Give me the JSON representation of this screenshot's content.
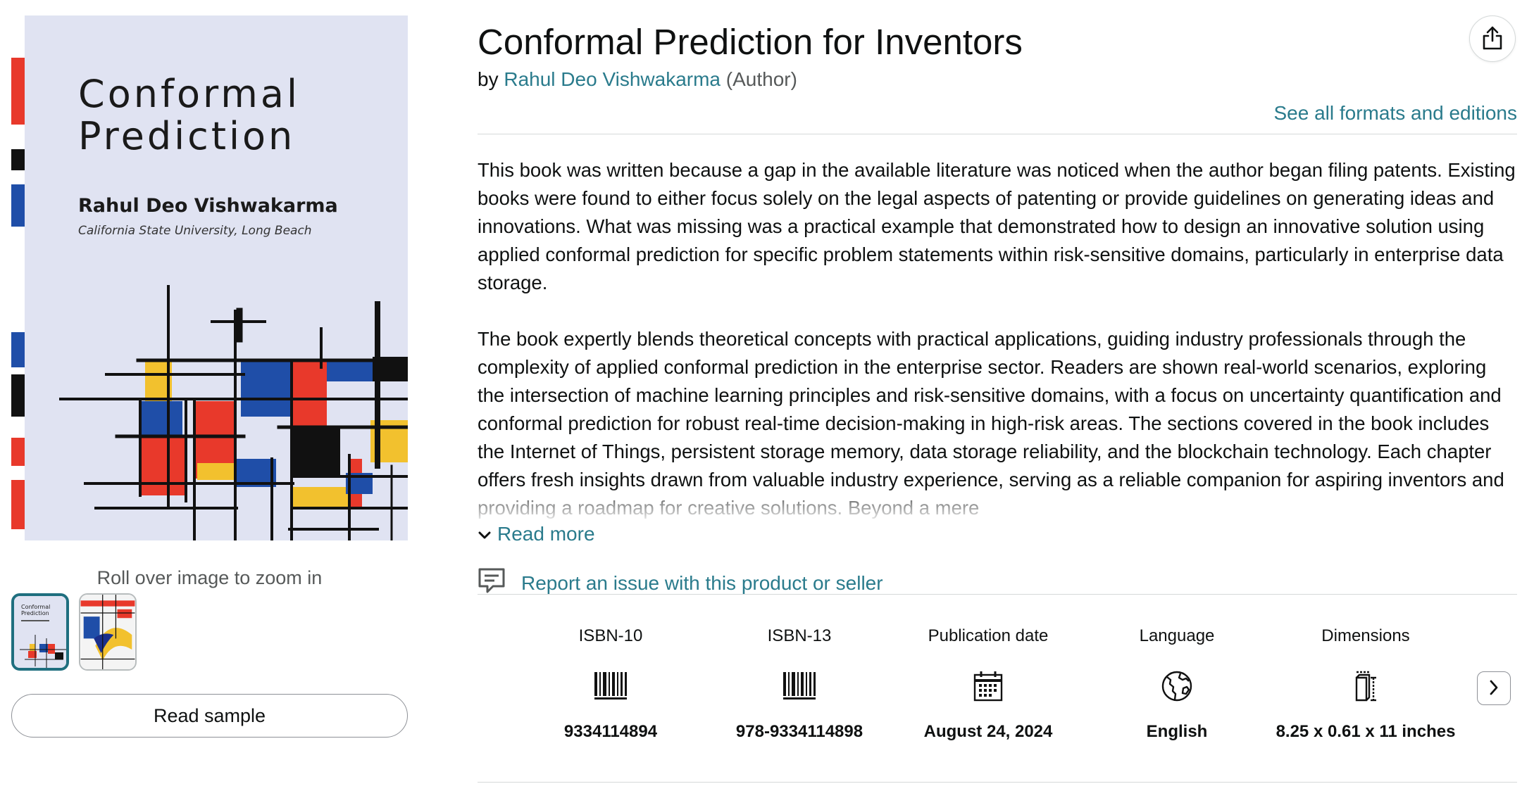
{
  "product": {
    "title": "Conformal Prediction for Inventors",
    "by_prefix": "by",
    "author": "Rahul Deo Vishwakarma",
    "author_role": "(Author)",
    "see_all_formats": "See all formats and editions"
  },
  "cover": {
    "title_line1": "Conformal",
    "title_line2": "Prediction",
    "author": "Rahul Deo Vishwakarma",
    "affiliation": "California State University, Long Beach",
    "background_color": "#e0e3f2",
    "accent_colors": {
      "red": "#e8392b",
      "blue": "#1f4ea8",
      "yellow": "#f2c12e"
    }
  },
  "gallery": {
    "zoom_hint": "Roll over image to zoom in",
    "read_sample_label": "Read sample",
    "thumb_cover_title_line1": "Conformal",
    "thumb_cover_title_line2": "Prediction"
  },
  "description": {
    "paragraphs": [
      "This book was written because a gap in the available literature was noticed when the author began filing patents. Existing books were found to either focus solely on the legal aspects of patenting or provide guidelines on generating ideas and innovations. What was missing was a practical example that demonstrated how to design an innovative solution using applied conformal prediction for specific problem statements within risk-sensitive domains, particularly in enterprise data storage.",
      "The book expertly blends theoretical concepts with practical applications, guiding industry professionals through the complexity of applied conformal prediction in the enterprise sector. Readers are shown real-world scenarios, exploring the intersection of machine learning principles and risk-sensitive domains, with a focus on uncertainty quantification and conformal prediction for robust real-time decision-making in high-risk areas. The sections covered in the book includes the Internet of Things, persistent storage memory, data storage reliability, and the blockchain technology. Each chapter offers fresh insights drawn from valuable industry experience, serving as a reliable companion for aspiring inventors and providing a roadmap for creative solutions. Beyond a mere"
    ],
    "read_more_label": "Read more"
  },
  "report": {
    "label": "Report an issue with this product or seller"
  },
  "details": [
    {
      "label": "ISBN-10",
      "icon": "barcode-icon",
      "value": "9334114894"
    },
    {
      "label": "ISBN-13",
      "icon": "barcode-icon",
      "value": "978-9334114898"
    },
    {
      "label": "Publication date",
      "icon": "calendar-icon",
      "value": "August 24, 2024"
    },
    {
      "label": "Language",
      "icon": "globe-icon",
      "value": "English"
    },
    {
      "label": "Dimensions",
      "icon": "dimensions-icon",
      "value": "8.25 x 0.61 x 11 inches"
    }
  ],
  "colors": {
    "link": "#2a7b8c",
    "text": "#0f1111",
    "muted": "#565959",
    "divider": "#d5d9d9"
  }
}
